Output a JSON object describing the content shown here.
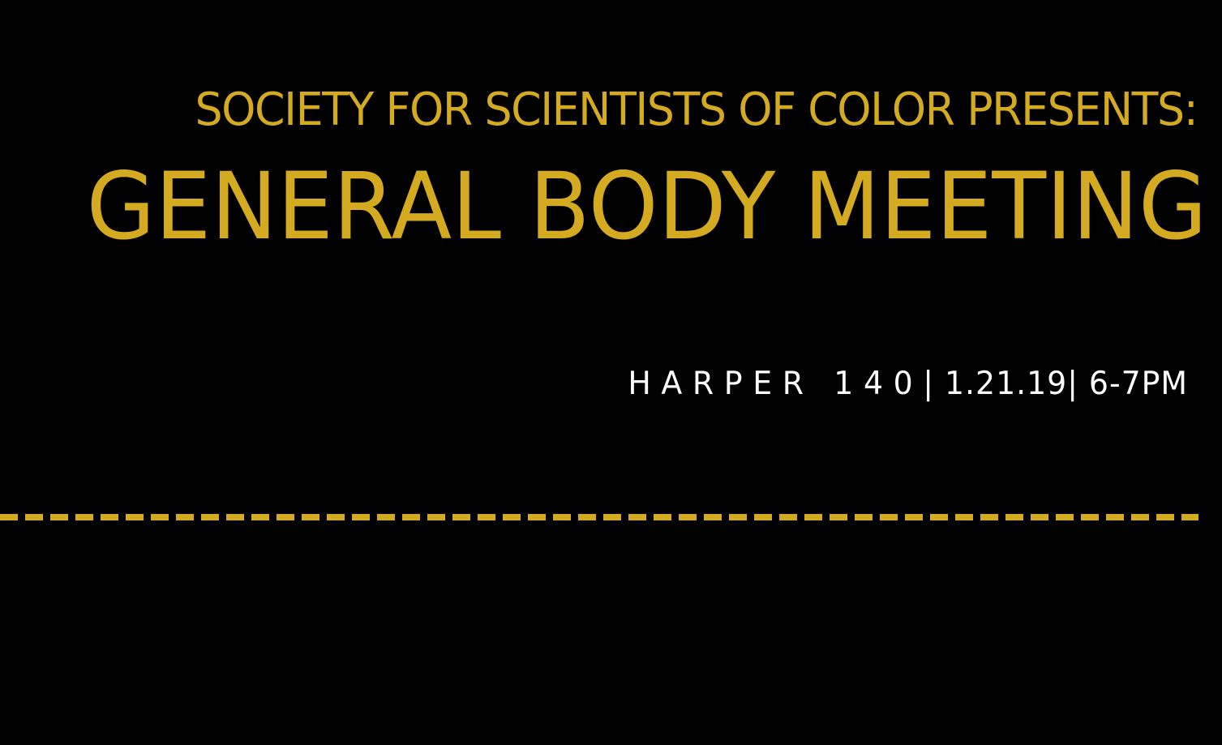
{
  "flyer": {
    "presenter": "SOCIETY FOR SCIENTISTS OF COLOR PRESENTS:",
    "title": "GENERAL BODY MEETING",
    "details": {
      "location": "HARPER 140",
      "date_time": "| 1.21.19| 6-7PM"
    }
  },
  "colors": {
    "background": "#000000",
    "accent": "#d4aa20",
    "details_text": "#ffffff"
  }
}
